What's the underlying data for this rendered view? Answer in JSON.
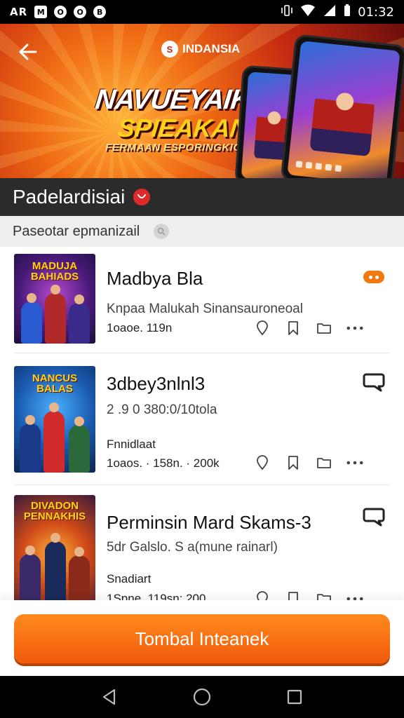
{
  "status_bar": {
    "carrier": "AR",
    "notifications": [
      "M",
      "O",
      "O",
      "B"
    ],
    "time": "01:32"
  },
  "banner": {
    "brand": "INDANSIA",
    "brand_logo_letter": "S",
    "headline_1": "NAVUEYAIK",
    "headline_2": "SPIEAKAN",
    "headline_3": "FERMAAN ESPORINGKIORS"
  },
  "section": {
    "title": "Padelardisiai",
    "filter": "Paseotar epmanizail"
  },
  "items": [
    {
      "thumb_title": "MADUJA BAHIADS",
      "title": "Madbya Bla",
      "subtitle": "Knpaa Malukah Sinansauroneoal",
      "meta": "",
      "stats": "1oaoe. 119n"
    },
    {
      "thumb_title": "NANCUS BALAS",
      "title": "3dbey3nlnl3",
      "subtitle": "2 .9 0 380:0/10tola",
      "meta": "Fnnidlaat",
      "stats": "1oaos. · 158n. · 200k"
    },
    {
      "thumb_title": "DIVADON PENNAKHIS",
      "title": "Perminsin Mard Skams-3",
      "subtitle": "5dr Galslo. S a(mune rainarl)",
      "meta": "Snadiart",
      "stats": "1Spne. 119sn: 200"
    }
  ],
  "cta": {
    "label": "Tombal Inteanek"
  },
  "colors": {
    "accent": "#f05a0a",
    "banner_red": "#c52a12",
    "section_bg": "#2b2b2b",
    "badge_red": "#e02a2a"
  }
}
